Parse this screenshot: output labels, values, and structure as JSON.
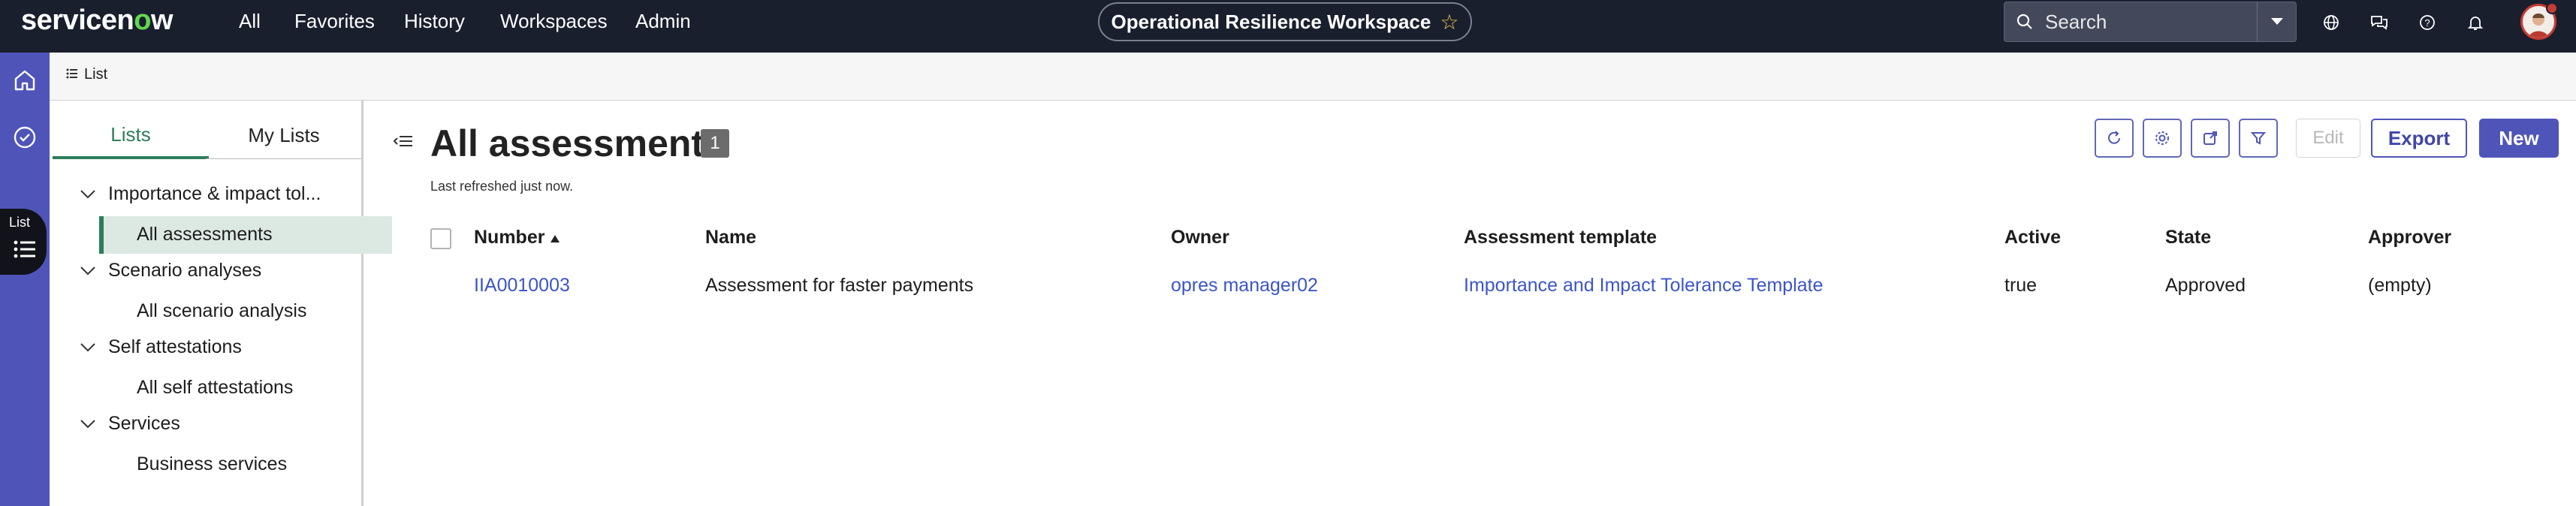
{
  "brand": {
    "logo_prefix": "servicen",
    "logo_o": "o",
    "logo_suffix": "w"
  },
  "topnav": {
    "items": [
      "All",
      "Favorites",
      "History",
      "Workspaces",
      "Admin"
    ],
    "workspace_title": "Operational Resilience Workspace",
    "search_placeholder": "Search",
    "icons": [
      "globe-icon",
      "chat-icon",
      "help-icon",
      "bell-icon"
    ]
  },
  "rail": {
    "tooltip": "List",
    "icons": [
      "home-icon",
      "check-circle-icon",
      "list-icon"
    ]
  },
  "tabbar": {
    "tab_label": "List"
  },
  "sidebar": {
    "tabs": [
      "Lists",
      "My Lists"
    ],
    "groups": [
      {
        "label": "Importance & impact tol...",
        "items": [
          "All assessments"
        ]
      },
      {
        "label": "Scenario analyses",
        "items": [
          "All scenario analysis"
        ]
      },
      {
        "label": "Self attestations",
        "items": [
          "All self attestations"
        ]
      },
      {
        "label": "Services",
        "items": [
          "Business services"
        ]
      }
    ]
  },
  "main": {
    "title": "All assessments",
    "count": "1",
    "refreshed": "Last refreshed just now.",
    "buttons": {
      "edit": "Edit",
      "export": "Export",
      "new": "New"
    },
    "columns": [
      "Number",
      "Name",
      "Owner",
      "Assessment template",
      "Active",
      "State",
      "Approver"
    ],
    "rows": [
      {
        "number": "IIA0010003",
        "name": "Assessment for faster payments",
        "owner": "opres manager02",
        "template": "Importance and Impact Tolerance Template",
        "active": "true",
        "state": "Approved",
        "approver": "(empty)"
      }
    ]
  },
  "colors": {
    "topnav": "#1a1f2e",
    "rail": "#4f55b8",
    "accent": "#2e7d5a",
    "link": "#3b55c9"
  }
}
